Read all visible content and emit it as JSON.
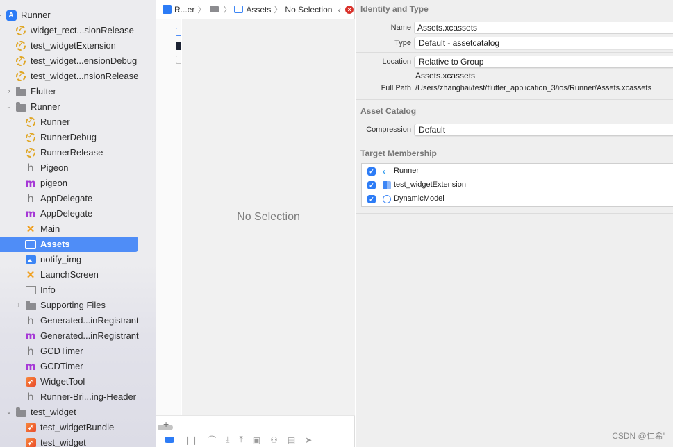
{
  "navigator": {
    "items": [
      {
        "label": "Runner",
        "icon": "project-icon",
        "disclosure": "open"
      },
      {
        "label": "widget_rect...sionRelease",
        "icon": "config-icon"
      },
      {
        "label": "test_widgetExtension",
        "icon": "config-icon"
      },
      {
        "label": "test_widget...ensionDebug",
        "icon": "config-icon"
      },
      {
        "label": "test_widget...nsionRelease",
        "icon": "config-icon"
      },
      {
        "label": "Flutter",
        "icon": "folder-icon",
        "disclosure": "closed"
      },
      {
        "label": "Runner",
        "icon": "folder-icon",
        "disclosure": "open"
      },
      {
        "label": "Runner",
        "icon": "config-icon"
      },
      {
        "label": "RunnerDebug",
        "icon": "config-icon"
      },
      {
        "label": "RunnerRelease",
        "icon": "config-icon"
      },
      {
        "label": "Pigeon",
        "icon": "header-h-icon"
      },
      {
        "label": "pigeon",
        "icon": "objc-m-icon"
      },
      {
        "label": "AppDelegate",
        "icon": "header-h-icon"
      },
      {
        "label": "AppDelegate",
        "icon": "objc-m-icon"
      },
      {
        "label": "Main",
        "icon": "storyboard-icon"
      },
      {
        "label": "Assets",
        "icon": "assets-icon",
        "selected": true
      },
      {
        "label": "notify_img",
        "icon": "image-icon"
      },
      {
        "label": "LaunchScreen",
        "icon": "storyboard-icon"
      },
      {
        "label": "Info",
        "icon": "plist-icon"
      },
      {
        "label": "Supporting Files",
        "icon": "folder-icon",
        "disclosure": "closed"
      },
      {
        "label": "Generated...inRegistrant",
        "icon": "header-h-icon"
      },
      {
        "label": "Generated...inRegistrant",
        "icon": "objc-m-icon"
      },
      {
        "label": "GCDTimer",
        "icon": "header-h-icon"
      },
      {
        "label": "GCDTimer",
        "icon": "objc-m-icon"
      },
      {
        "label": "WidgetTool",
        "icon": "swift-icon"
      },
      {
        "label": "Runner-Bri...ing-Header",
        "icon": "header-h-icon"
      },
      {
        "label": "test_widget",
        "icon": "folder-icon",
        "disclosure": "open"
      },
      {
        "label": "test_widgetBundle",
        "icon": "swift-icon"
      },
      {
        "label": "test_widget",
        "icon": "swift-icon"
      }
    ]
  },
  "jumpbar": {
    "project": "R...er",
    "assets": "Assets",
    "selection": "No Selection"
  },
  "editor": {
    "empty_text": "No Selection",
    "add_label": "+"
  },
  "inspector": {
    "identity_title": "Identity and Type",
    "name_label": "Name",
    "name_value": "Assets.xcassets",
    "type_label": "Type",
    "type_value": "Default - assetcatalog",
    "location_label": "Location",
    "location_value": "Relative to Group",
    "location_file": "Assets.xcassets",
    "fullpath_label": "Full Path",
    "fullpath_value": "/Users/zhanghai/test/flutter_application_3/ios/Runner/Assets.xcassets",
    "catalog_title": "Asset Catalog",
    "compression_label": "Compression",
    "compression_value": "Default",
    "membership_title": "Target Membership",
    "targets": [
      {
        "label": "Runner",
        "checked": true,
        "icon": "flutter-icon"
      },
      {
        "label": "test_widgetExtension",
        "checked": true,
        "icon": "widget-extension-icon"
      },
      {
        "label": "DynamicModel",
        "checked": true,
        "icon": "framework-icon"
      }
    ]
  },
  "watermark": "CSDN @仁希'",
  "colors": {
    "accent": "#4f8df7",
    "checkbox": "#2d7cf6",
    "error": "#d9322b",
    "sidebar_bg": "#ececef",
    "inspector_bg": "#efefef"
  }
}
